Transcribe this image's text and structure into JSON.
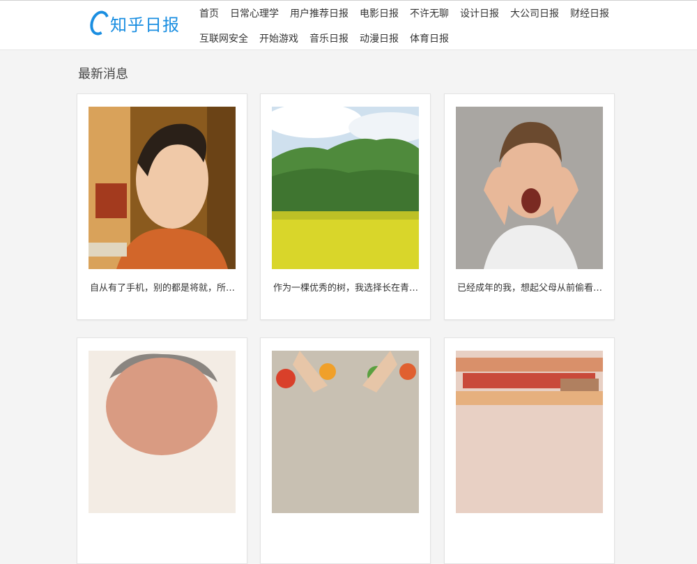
{
  "brand": {
    "name": "知乎日报",
    "color": "#1a8ee1"
  },
  "nav": {
    "row1": [
      "首页",
      "日常心理学",
      "用户推荐日报",
      "电影日报",
      "不许无聊",
      "设计日报",
      "大公司日报",
      "财经日报"
    ],
    "row2": [
      "互联网安全",
      "开始游戏",
      "音乐日报",
      "动漫日报",
      "体育日报"
    ]
  },
  "section": {
    "title": "最新消息"
  },
  "cards": [
    {
      "title": "自从有了手机，别的都是将就，所…",
      "image": "woman-portrait"
    },
    {
      "title": "作为一棵优秀的树，我选择长在青…",
      "image": "green-hills-flower-field"
    },
    {
      "title": "已经成年的我，想起父母从前偷看…",
      "image": "angry-boy"
    },
    {
      "title": "",
      "image": "old-man-face"
    },
    {
      "title": "",
      "image": "hands-with-vegetables"
    },
    {
      "title": "",
      "image": "banknotes"
    }
  ]
}
